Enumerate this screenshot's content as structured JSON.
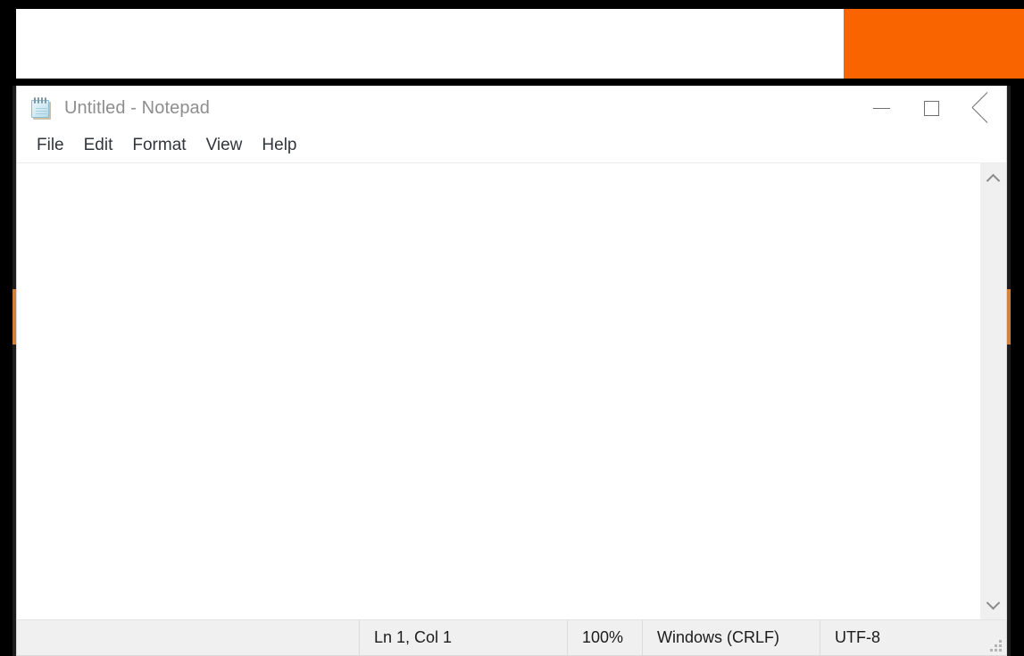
{
  "window": {
    "title": "Untitled - Notepad",
    "app_icon": "notepad-icon",
    "controls": {
      "minimize": "—",
      "maximize": "□",
      "close": "×",
      "minimize_name": "minimize",
      "maximize_name": "maximize",
      "close_name": "close"
    }
  },
  "menu": {
    "items": [
      {
        "label": "File"
      },
      {
        "label": "Edit"
      },
      {
        "label": "Format"
      },
      {
        "label": "View"
      },
      {
        "label": "Help"
      }
    ]
  },
  "editor": {
    "content": "",
    "placeholder": ""
  },
  "scrollbar": {
    "up_arrow_icon": "chevron-up-icon",
    "down_arrow_icon": "chevron-down-icon",
    "thumb_visible": false
  },
  "status_bar": {
    "cursor_position": "Ln 1, Col 1",
    "zoom": "100%",
    "line_ending": "Windows (CRLF)",
    "encoding": "UTF-8",
    "resize_grip_icon": "resize-grip-icon"
  },
  "background": {
    "white_band": "#ffffff",
    "orange_block": "#FA6400",
    "page_backdrop": "#000000",
    "edge_sliver": "#1d1d1d",
    "edge_sliver_accent": "#d2813a"
  },
  "colors": {
    "title_text": "#8e8e8e",
    "menu_text": "#30363c",
    "status_text": "#1c1c1c",
    "window_chrome": "#ffffff",
    "status_bar_bg": "#f0f0f0",
    "scrollbar_bg": "#f0f0f0"
  }
}
